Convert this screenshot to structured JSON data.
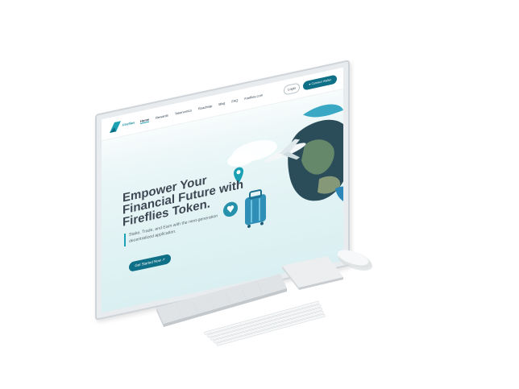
{
  "site": {
    "logo_text": "Fireflies",
    "nav": {
      "items": [
        "Home",
        "Rewards",
        "Tokenomics",
        "Roadmap",
        "Blog",
        "FAQ",
        "Fireflies.com"
      ],
      "active_index": 0,
      "login_label": "Login",
      "connect_label": "● Connect Wallet"
    },
    "hero": {
      "title_lines": [
        "Empower Your",
        "Financial Future with",
        "Fireflies Token."
      ],
      "subtitle": "Stake, Trade, and Earn with the next-generation decentralized application.",
      "cta_label": "Get Started Now ↗"
    }
  },
  "colors": {
    "brand_teal": "#1aa0b2",
    "brand_dark": "#0f6f86",
    "title_text": "#3d4753"
  }
}
